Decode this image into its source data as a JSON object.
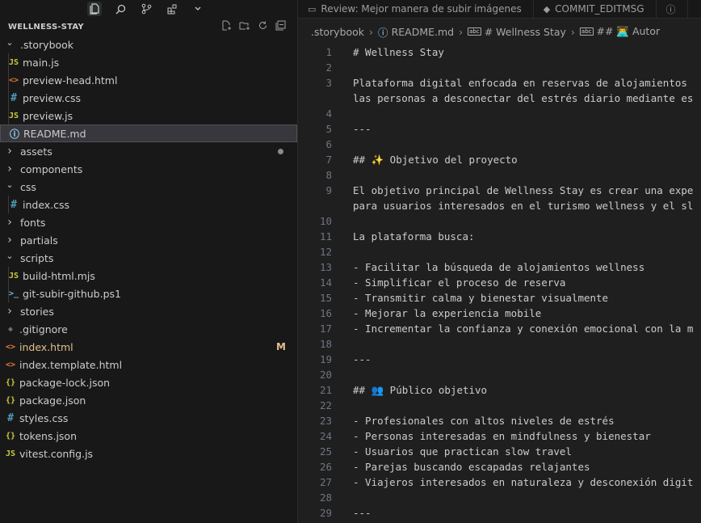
{
  "activity_bar": {
    "icons": [
      "files-icon",
      "search-icon",
      "source-control-icon",
      "extensions-icon",
      "chevron-down-icon"
    ]
  },
  "explorer": {
    "root": "WELLNESS-STAY",
    "tree": [
      {
        "label": ".storybook",
        "type": "folder",
        "open": true,
        "depth": 0
      },
      {
        "label": "main.js",
        "type": "js",
        "depth": 1
      },
      {
        "label": "preview-head.html",
        "type": "html",
        "depth": 1
      },
      {
        "label": "preview.css",
        "type": "css",
        "depth": 1
      },
      {
        "label": "preview.js",
        "type": "js",
        "depth": 1
      },
      {
        "label": "README.md",
        "type": "info",
        "depth": 1,
        "selected": true
      },
      {
        "label": "assets",
        "type": "folder",
        "open": false,
        "depth": 0,
        "dot": true
      },
      {
        "label": "components",
        "type": "folder",
        "open": false,
        "depth": 0
      },
      {
        "label": "css",
        "type": "folder",
        "open": true,
        "depth": 0
      },
      {
        "label": "index.css",
        "type": "css",
        "depth": 1
      },
      {
        "label": "fonts",
        "type": "folder",
        "open": false,
        "depth": 0
      },
      {
        "label": "partials",
        "type": "folder",
        "open": false,
        "depth": 0
      },
      {
        "label": "scripts",
        "type": "folder",
        "open": true,
        "depth": 0
      },
      {
        "label": "build-html.mjs",
        "type": "js",
        "depth": 1
      },
      {
        "label": "git-subir-github.ps1",
        "type": "ps1",
        "depth": 1
      },
      {
        "label": "stories",
        "type": "folder",
        "open": false,
        "depth": 0
      },
      {
        "label": ".gitignore",
        "type": "git",
        "depth": 0
      },
      {
        "label": "index.html",
        "type": "html",
        "depth": 0,
        "modified": true,
        "badge": "M"
      },
      {
        "label": "index.template.html",
        "type": "html",
        "depth": 0
      },
      {
        "label": "package-lock.json",
        "type": "json",
        "depth": 0
      },
      {
        "label": "package.json",
        "type": "json",
        "depth": 0
      },
      {
        "label": "styles.css",
        "type": "css",
        "depth": 0
      },
      {
        "label": "tokens.json",
        "type": "json",
        "depth": 0
      },
      {
        "label": "vitest.config.js",
        "type": "js",
        "depth": 0
      }
    ]
  },
  "tabs": [
    {
      "label": "Review: Mejor manera de subir imágenes",
      "icon": "review-icon"
    },
    {
      "label": "COMMIT_EDITMSG",
      "icon": "git-commit-icon"
    }
  ],
  "breadcrumbs": [
    ".storybook",
    "README.md",
    "# Wellness Stay",
    "## 👨‍💻 Autor"
  ],
  "code_lines": [
    {
      "n": "1",
      "text": "# Wellness Stay"
    },
    {
      "n": "2",
      "text": ""
    },
    {
      "n": "3",
      "text": "Plataforma digital enfocada en reservas de alojamientos"
    },
    {
      "n": "",
      "text": "las personas a desconectar del estrés diario mediante es"
    },
    {
      "n": "4",
      "text": ""
    },
    {
      "n": "5",
      "text": "---"
    },
    {
      "n": "6",
      "text": ""
    },
    {
      "n": "7",
      "text": "## ✨ Objetivo del proyecto"
    },
    {
      "n": "8",
      "text": ""
    },
    {
      "n": "9",
      "text": "El objetivo principal de Wellness Stay es crear una expe"
    },
    {
      "n": "",
      "text": "para usuarios interesados en el turismo wellness y el sl"
    },
    {
      "n": "10",
      "text": ""
    },
    {
      "n": "11",
      "text": "La plataforma busca:"
    },
    {
      "n": "12",
      "text": ""
    },
    {
      "n": "13",
      "text": "- Facilitar la búsqueda de alojamientos wellness"
    },
    {
      "n": "14",
      "text": "- Simplificar el proceso de reserva"
    },
    {
      "n": "15",
      "text": "- Transmitir calma y bienestar visualmente"
    },
    {
      "n": "16",
      "text": "- Mejorar la experiencia mobile"
    },
    {
      "n": "17",
      "text": "- Incrementar la confianza y conexión emocional con la m"
    },
    {
      "n": "18",
      "text": ""
    },
    {
      "n": "19",
      "text": "---"
    },
    {
      "n": "20",
      "text": ""
    },
    {
      "n": "21",
      "text": "## 👥 Público objetivo"
    },
    {
      "n": "22",
      "text": ""
    },
    {
      "n": "23",
      "text": "- Profesionales con altos niveles de estrés"
    },
    {
      "n": "24",
      "text": "- Personas interesadas en mindfulness y bienestar"
    },
    {
      "n": "25",
      "text": "- Usuarios que practican slow travel"
    },
    {
      "n": "26",
      "text": "- Parejas buscando escapadas relajantes"
    },
    {
      "n": "27",
      "text": "- Viajeros interesados en naturaleza y desconexión digit"
    },
    {
      "n": "28",
      "text": ""
    },
    {
      "n": "29",
      "text": "---"
    }
  ],
  "colors": {
    "js": "#cbcb41",
    "html": "#e37933",
    "css": "#519aba",
    "json": "#cbcb41",
    "info": "#9cdcfe",
    "ps1": "#69b8e8",
    "git": "#6d6d6d",
    "modified": "#e2c08d",
    "text": "#cccccc"
  }
}
